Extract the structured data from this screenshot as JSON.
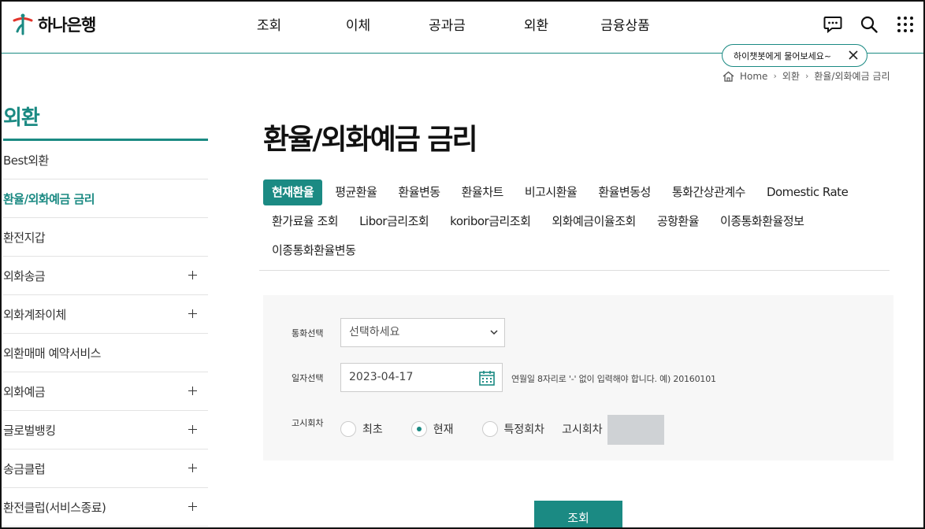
{
  "brand": {
    "name": "하나은행",
    "color": "#1b8a83"
  },
  "gnb": {
    "items": [
      "조회",
      "이체",
      "공과금",
      "외환",
      "금융상품"
    ]
  },
  "util": {
    "icons": [
      "chatbot-icon",
      "search-icon",
      "all-menu-icon"
    ]
  },
  "chatbot": {
    "tooltip": "하이챗봇에게 물어보세요~"
  },
  "breadcrumb": {
    "home": "Home",
    "level1": "외환",
    "level2": "환율/외화예금 금리"
  },
  "sidebar": {
    "title": "외환",
    "items": [
      {
        "label": "Best외환",
        "expandable": false,
        "active": false
      },
      {
        "label": "환율/외화예금 금리",
        "expandable": false,
        "active": true
      },
      {
        "label": "환전지갑",
        "expandable": false,
        "active": false
      },
      {
        "label": "외화송금",
        "expandable": true,
        "active": false
      },
      {
        "label": "외화계좌이체",
        "expandable": true,
        "active": false
      },
      {
        "label": "외환매매 예약서비스",
        "expandable": false,
        "active": false
      },
      {
        "label": "외화예금",
        "expandable": true,
        "active": false
      },
      {
        "label": "글로벌뱅킹",
        "expandable": true,
        "active": false
      },
      {
        "label": "송금클럽",
        "expandable": true,
        "active": false
      },
      {
        "label": "환전클럽(서비스종료)",
        "expandable": true,
        "active": false
      }
    ]
  },
  "page": {
    "title": "환율/외화예금 금리"
  },
  "tabs": [
    "현재환율",
    "평균환율",
    "환율변동",
    "환율차트",
    "비고시환율",
    "환율변동성",
    "통화간상관계수",
    "Domestic Rate",
    "환가료율 조회",
    "Libor금리조회",
    "koribor금리조회",
    "외화예금이율조회",
    "공항환율",
    "이종통화환율정보",
    "이종통화환율변동"
  ],
  "form": {
    "currency_label": "통화선택",
    "currency_value": "선택하세요",
    "date_label": "일자선택",
    "date_value": "2023-04-17",
    "date_hint": "연월일 8자리로 '-' 없이 입력해야 합니다. 예) 20160101",
    "notice_label": "고시회차",
    "radio_first": "최초",
    "radio_current": "현재",
    "radio_specific": "특정회차",
    "notice_round_label": "고시회차",
    "selected_radio": "현재"
  },
  "actions": {
    "search": "조회"
  }
}
